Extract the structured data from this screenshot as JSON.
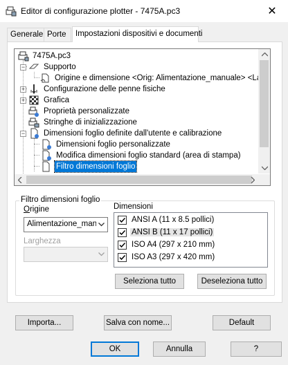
{
  "window": {
    "title": "Editor di configurazione plotter - 7475A.pc3",
    "close_glyph": "✕"
  },
  "tabs": [
    {
      "label": "Generale",
      "active": false
    },
    {
      "label": "Porte",
      "active": false
    },
    {
      "label": "Impostazioni dispositivi e documenti",
      "active": true
    }
  ],
  "tree": {
    "root": "7475A.pc3",
    "items": [
      {
        "label": "Supporto",
        "icon": "paper-supply-icon",
        "expander": "−"
      },
      {
        "label": "Origine e dimensione <Orig:  Alimentazione_manuale> <Larg",
        "icon": "paper-icon"
      },
      {
        "label": "Configurazione delle penne fisiche",
        "icon": "pen-icon",
        "expander": "+"
      },
      {
        "label": "Grafica",
        "icon": "graphics-icon",
        "expander": "+"
      },
      {
        "label": "Proprietà personalizzate",
        "icon": "custom-properties-icon"
      },
      {
        "label": "Stringhe di inizializzazione",
        "icon": "init-strings-icon"
      },
      {
        "label": "Dimensioni foglio definite dall'utente e calibrazione",
        "icon": "user-paper-icon",
        "expander": "−"
      },
      {
        "label": "Dimensioni foglio personalizzate",
        "icon": "custom-paper-icon"
      },
      {
        "label": "Modifica dimensioni foglio standard (area di stampa)",
        "icon": "modify-paper-icon"
      },
      {
        "label": "Filtro dimensioni foglio",
        "icon": "paper-filter-icon",
        "selected": true
      }
    ]
  },
  "filter_group": {
    "title": "Filtro dimensioni foglio",
    "origin_label": "Origine",
    "origin_value": "Alimentazione_manu",
    "width_label": "Larghezza",
    "width_value": "",
    "dimensions_label": "Dimensioni",
    "dimensions": [
      {
        "label": "ANSI A (11 x 8.5 pollici)",
        "checked": true
      },
      {
        "label": "ANSI B (11 x 17 pollici)",
        "checked": true
      },
      {
        "label": "ISO A4 (297 x 210 mm)",
        "checked": true
      },
      {
        "label": "ISO A3 (297 x 420 mm)",
        "checked": true
      }
    ],
    "select_all": "Seleziona tutto",
    "deselect_all": "Deseleziona tutto"
  },
  "panel_buttons": {
    "import": "Importa...",
    "save_as": "Salva con nome...",
    "default": "Default"
  },
  "dialog_buttons": {
    "ok": "OK",
    "cancel": "Annulla",
    "help": "?"
  }
}
